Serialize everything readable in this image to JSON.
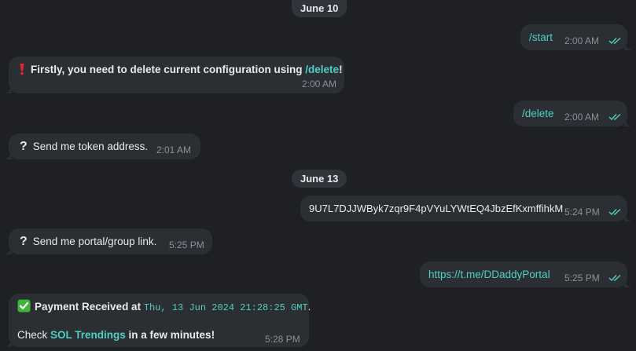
{
  "dates": {
    "d1": "June 10",
    "d2": "June 13"
  },
  "messages": {
    "m1": {
      "text": "/start",
      "time": "2:00 AM"
    },
    "m2": {
      "pre": "Firstly, you need to delete current configuration using ",
      "cmd": "/delete",
      "post": "!",
      "time": "2:00 AM"
    },
    "m3": {
      "text": "/delete",
      "time": "2:00 AM"
    },
    "m4": {
      "text": "Send me token address.",
      "time": "2:01 AM"
    },
    "m5": {
      "text": "9U7L7DJJWByk7zqr9F4pVYuLYWtEQ4JbzEfKxmffihkM",
      "time": "5:24 PM"
    },
    "m6": {
      "text": "Send me portal/group link.",
      "time": "5:25 PM"
    },
    "m7": {
      "text": "https://t.me/DDaddyPortal",
      "time": "5:25 PM"
    },
    "m8": {
      "line1_bold": "Payment Received at ",
      "line1_mono": "Thu, 13 Jun 2024 21:28:25 GMT",
      "line1_end": ".",
      "line2_pre": "Check ",
      "line2_link": "SOL Trendings",
      "line2_post": " in a few minutes!",
      "time": "5:28 PM"
    }
  },
  "icons": {
    "exclamation": "red-exclamation-icon",
    "question": "white-question-icon",
    "check": "green-check-mark-icon",
    "read": "double-check-read-icon"
  },
  "colors": {
    "background": "#1e2024",
    "bubble": "#2b2e33",
    "accent": "#4fd0c3",
    "time": "#8b9097",
    "exclamation": "#e8262f",
    "check_box": "#3fb53c"
  }
}
